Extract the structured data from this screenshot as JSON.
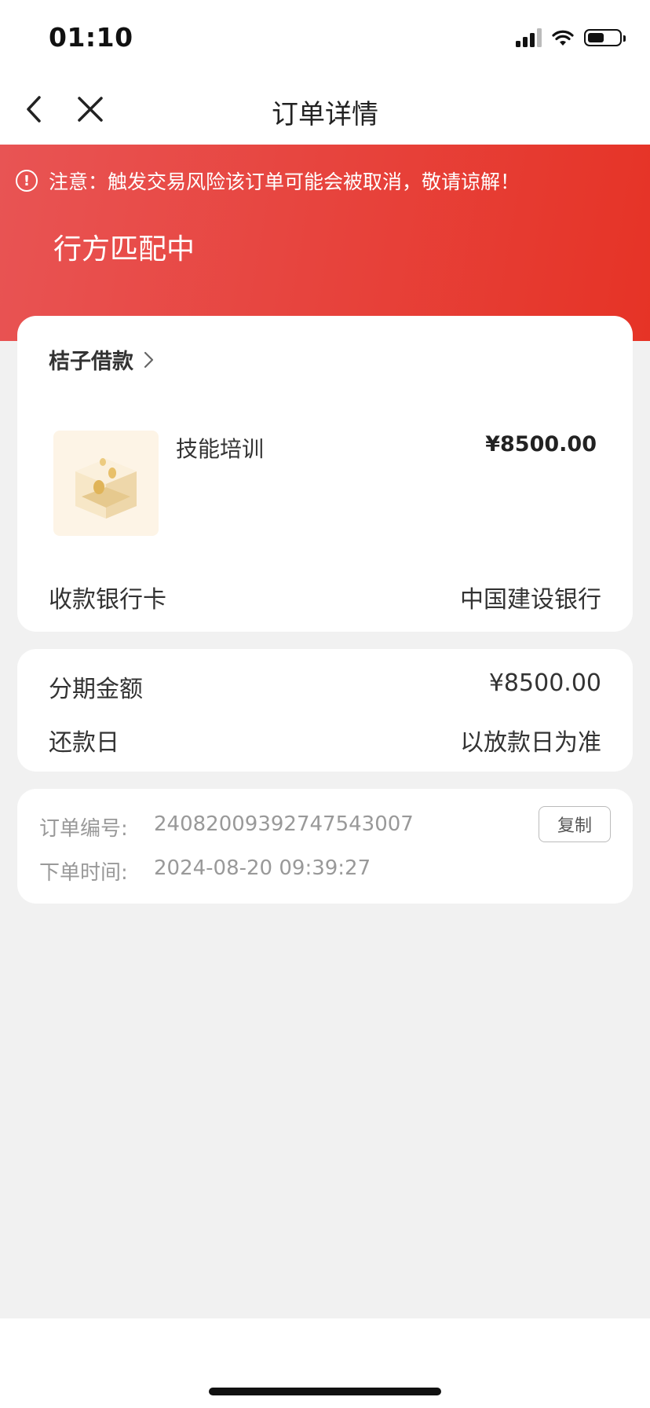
{
  "status_bar": {
    "time": "01:10",
    "battery_level": 0.55
  },
  "navbar": {
    "title": "订单详情",
    "icons": [
      "chevron-left-icon",
      "close-icon"
    ]
  },
  "banner": {
    "warning_text": "注意：触发交易风险该订单可能会被取消，敬请谅解！",
    "warning_icon": "!",
    "status": "行方匹配中",
    "colors": {
      "from": "#e85454",
      "to": "#e63326"
    }
  },
  "order_card": {
    "merchant": "桔子借款",
    "product": {
      "name": "技能培训",
      "price": "¥8500.00"
    },
    "bank_label": "收款银行卡",
    "bank_value": "中国建设银行"
  },
  "installment_card": {
    "amount_label": "分期金额",
    "amount_value": "¥8500.00",
    "due_label": "还款日",
    "due_value": "以放款日为准"
  },
  "info_card": {
    "order_no_label": "订单编号:",
    "order_no": "240820093927475430​07",
    "copy_label": "复制",
    "time_label": "下单时间:",
    "time_value": "2024-08-20 09:39:27"
  }
}
